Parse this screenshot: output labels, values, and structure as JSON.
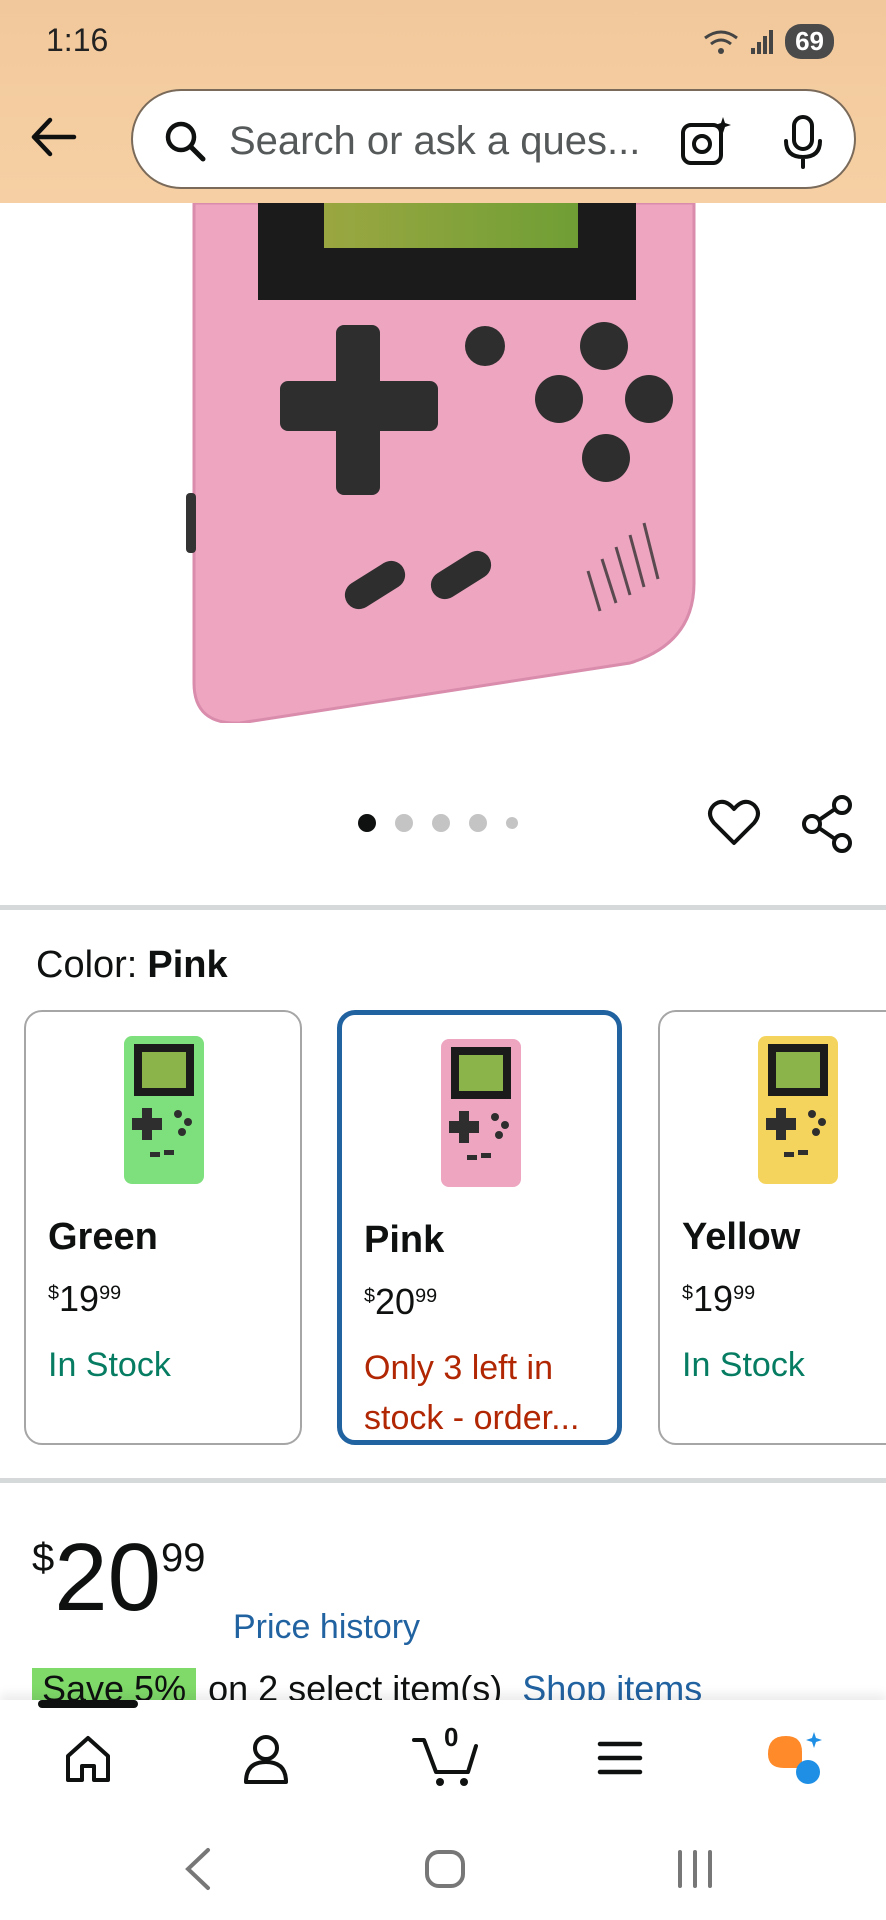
{
  "status_bar": {
    "time": "1:16",
    "battery": "69"
  },
  "search": {
    "placeholder": "Search or ask a ques..."
  },
  "carousel": {
    "total": 5,
    "active": 1
  },
  "color_selector": {
    "label": "Color:",
    "selected": "Pink",
    "options": [
      {
        "name": "Green",
        "currency": "$",
        "whole": "19",
        "cents": "99",
        "stock": "In Stock"
      },
      {
        "name": "Pink",
        "currency": "$",
        "whole": "20",
        "cents": "99",
        "stock": "Only 3 left in stock - order..."
      },
      {
        "name": "Yellow",
        "currency": "$",
        "whole": "19",
        "cents": "99",
        "stock": "In Stock"
      }
    ]
  },
  "price": {
    "currency": "$",
    "whole": "20",
    "cents": "99",
    "history_link": "Price history"
  },
  "promo": {
    "badge": "Save 5%",
    "text": "on 2 select item(s)",
    "link": "Shop items"
  },
  "bottom_nav": {
    "cart_count": "0"
  },
  "colors": {
    "header": "#f1c89b",
    "link": "#2162a1",
    "in_stock": "#067d62",
    "low_stock": "#b12704",
    "selected_border": "#2162a1"
  }
}
